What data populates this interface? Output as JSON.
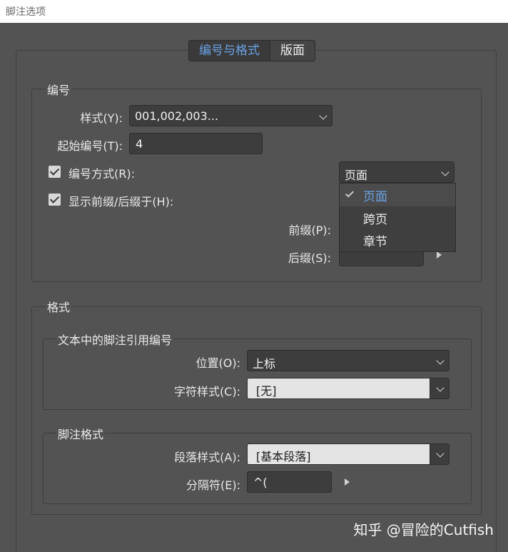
{
  "window": {
    "title": "脚注选项"
  },
  "tabs": [
    {
      "label": "编号与格式",
      "active": true
    },
    {
      "label": "版面",
      "active": false
    }
  ],
  "numbering": {
    "group_title": "编号",
    "style_label": "样式(Y):",
    "style_value": "001,002,003...",
    "start_label": "起始编号(T):",
    "start_value": "4",
    "restart_label": "编号方式(R):",
    "restart_checked": true,
    "restart_value": "页面",
    "prefix_suffix_label": "显示前缀/后缀于(H):",
    "prefix_suffix_checked": true,
    "prefix_label": "前缀(P):",
    "suffix_label": "后缀(S):"
  },
  "dropdown_menu": {
    "items": [
      {
        "label": "页面",
        "selected": true
      },
      {
        "label": "跨页",
        "selected": false
      },
      {
        "label": "章节",
        "selected": false
      }
    ]
  },
  "formatting": {
    "group_title": "格式",
    "reference": {
      "title": "文本中的脚注引用编号",
      "position_label": "位置(O):",
      "position_value": "上标",
      "char_style_label": "字符样式(C):",
      "char_style_value": "[无]"
    },
    "footnote": {
      "title": "脚注格式",
      "para_style_label": "段落样式(A):",
      "para_style_value": "[基本段落]",
      "separator_label": "分隔符(E):",
      "separator_value": "^("
    }
  },
  "watermark": "知乎 @冒险的Cutfish",
  "colors": {
    "accent": "#6aa2e6",
    "background": "#535353"
  }
}
